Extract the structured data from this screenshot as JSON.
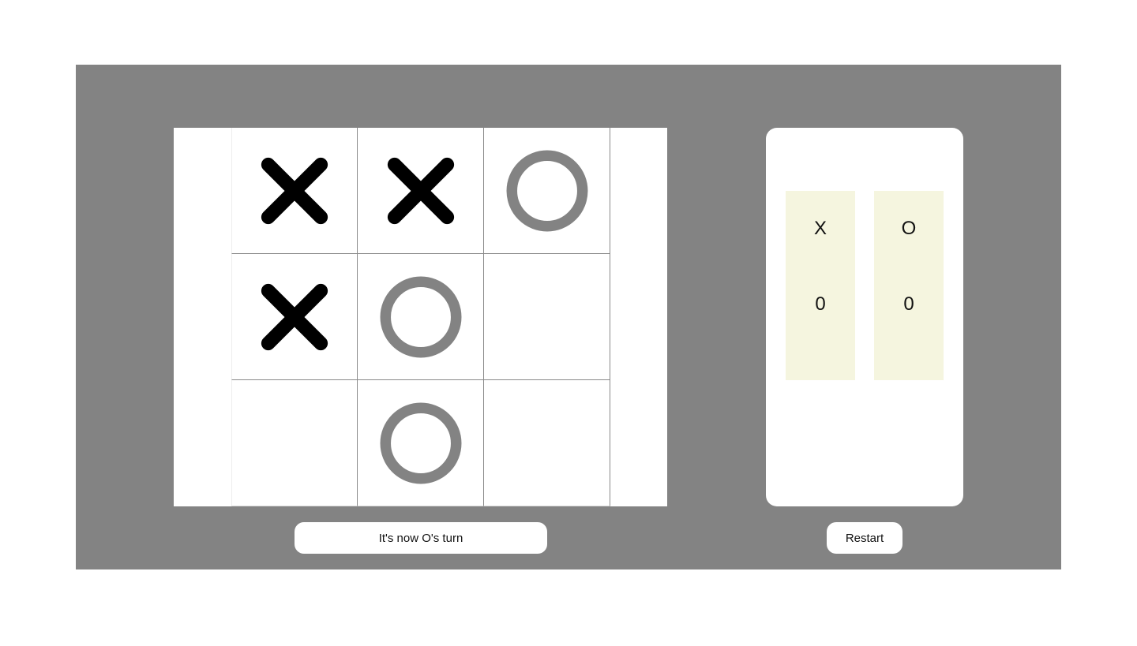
{
  "colors": {
    "panel_background": "#838383",
    "board_background": "#ffffff",
    "x_mark": "#000000",
    "o_mark": "#838383",
    "score_column": "#f5f5df"
  },
  "board": {
    "cells": [
      "X",
      "X",
      "O",
      "X",
      "O",
      "",
      "",
      "O",
      ""
    ]
  },
  "status": {
    "text": "It's now O's turn"
  },
  "scoreboard": {
    "players": [
      {
        "symbol": "X",
        "score": "0"
      },
      {
        "symbol": "O",
        "score": "0"
      }
    ]
  },
  "controls": {
    "restart_label": "Restart"
  }
}
